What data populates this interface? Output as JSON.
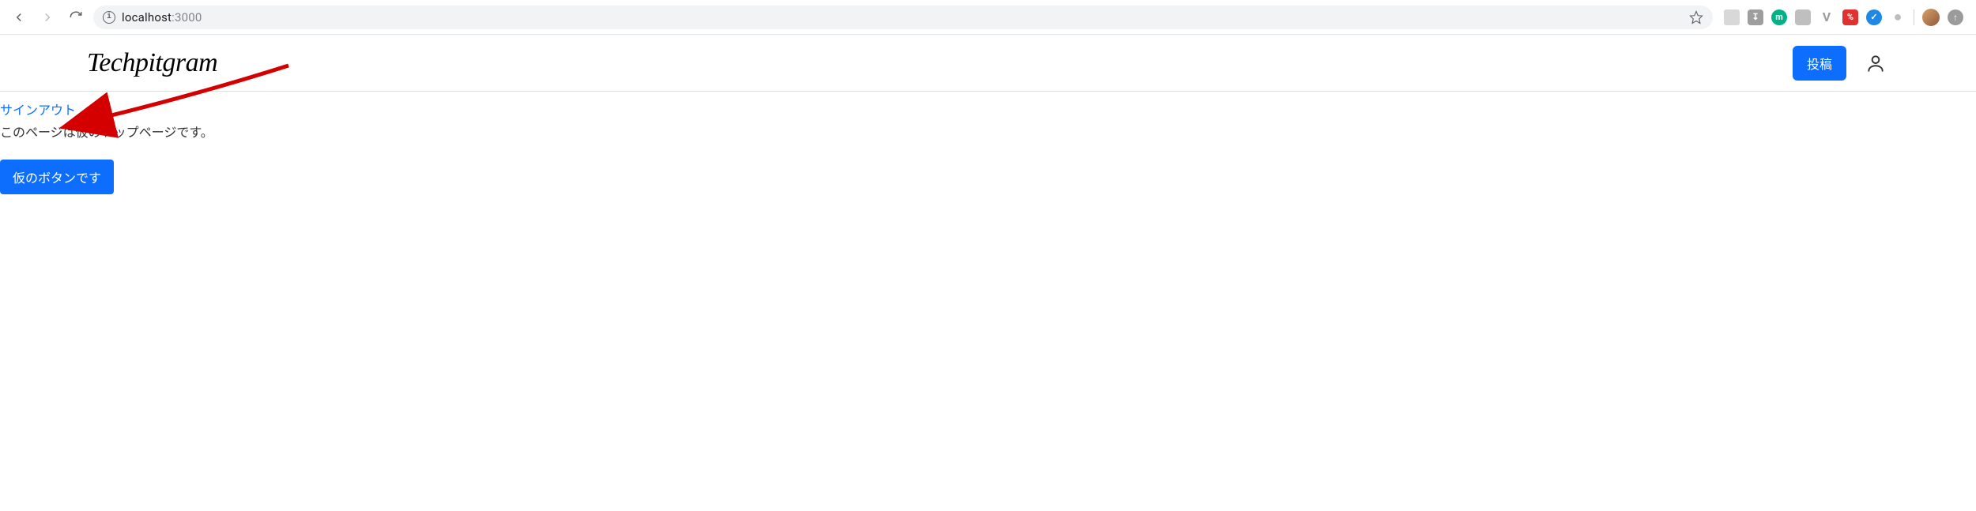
{
  "browser": {
    "url_host": "localhost",
    "url_port": ":3000",
    "extensions": [
      {
        "name": "ext-square-gray",
        "bg": "#d8d8d8",
        "label": ""
      },
      {
        "name": "ext-download-gray",
        "bg": "#9e9e9e",
        "label": ""
      },
      {
        "name": "ext-m-green",
        "bg": "#00b386",
        "label": "m"
      },
      {
        "name": "ext-cam-gray",
        "bg": "#bfbfbf",
        "label": ""
      },
      {
        "name": "ext-v-gray",
        "bg": "#9e9e9e",
        "label": "V"
      },
      {
        "name": "ext-percent-red",
        "bg": "#e03030",
        "label": "%"
      },
      {
        "name": "ext-check-blue",
        "bg": "#1e88e5",
        "label": "✓"
      },
      {
        "name": "ext-dot-gray",
        "bg": "#cfcfcf",
        "label": ""
      }
    ]
  },
  "header": {
    "logo": "Techpitgram",
    "post_button": "投稿"
  },
  "main": {
    "signout_link": "サインアウト",
    "placeholder_text": "このページは仮のトップページです。",
    "temp_button": "仮のボタンです"
  }
}
